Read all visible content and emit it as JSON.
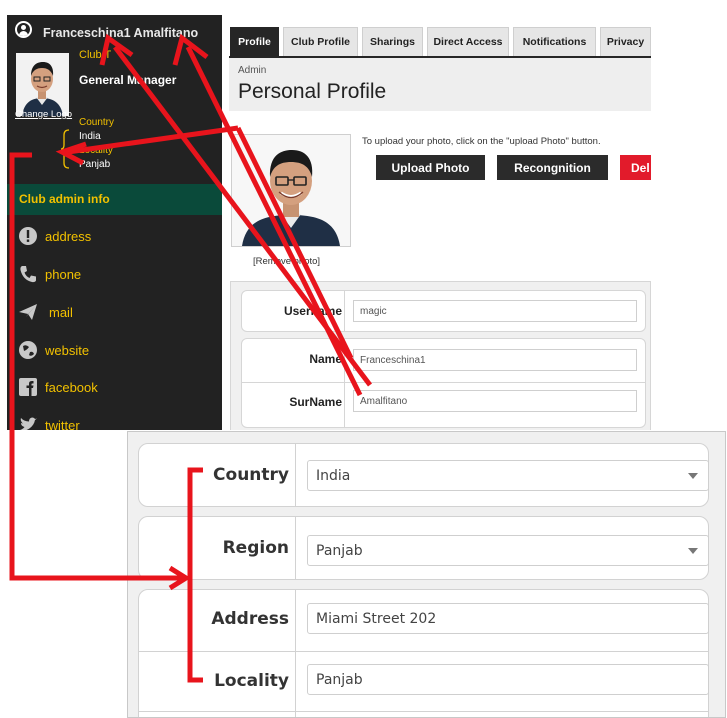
{
  "sidebar": {
    "user_name": "Franceschina1 Amalfitano",
    "club_label": "Club T",
    "role": "General Manager",
    "change_logo": "Change Logo",
    "location": [
      "Country",
      "India",
      "Locality",
      "Panjab"
    ],
    "club_admin_title": "Club admin info",
    "items": [
      {
        "label": "address",
        "icon": "exclamation-circle-icon"
      },
      {
        "label": "phone",
        "icon": "phone-icon"
      },
      {
        "label": "mail",
        "icon": "paper-plane-icon"
      },
      {
        "label": "website",
        "icon": "globe-icon"
      },
      {
        "label": "facebook",
        "icon": "facebook-icon"
      },
      {
        "label": "twitter",
        "icon": "twitter-icon"
      }
    ]
  },
  "tabs": [
    {
      "label": "Profile",
      "active": true
    },
    {
      "label": "Club Profile",
      "active": false
    },
    {
      "label": "Sharings",
      "active": false
    },
    {
      "label": "Direct Access",
      "active": false
    },
    {
      "label": "Notifications",
      "active": false
    },
    {
      "label": "Privacy",
      "active": false
    }
  ],
  "header": {
    "breadcrumb": "Admin",
    "title": "Personal Profile"
  },
  "photo": {
    "remove_label": "[Remove photo]",
    "hint": "To upload your photo, click on the \"upload Photo\" button.",
    "upload_label": "Upload Photo",
    "recognition_label": "Recongnition",
    "delete_label": "Del"
  },
  "form": {
    "username": {
      "label": "Username",
      "value": "magic"
    },
    "name": {
      "label": "Name",
      "value": "Franceschina1"
    },
    "surname": {
      "label": "SurName",
      "value": "Amalfitano"
    }
  },
  "zoom": {
    "country": {
      "label": "Country",
      "value": "India"
    },
    "region": {
      "label": "Region",
      "value": "Panjab"
    },
    "address": {
      "label": "Address",
      "value": "Miami Street 202"
    },
    "locality": {
      "label": "Locality",
      "value": "Panjab"
    }
  },
  "colors": {
    "accent_yellow": "#f2c100",
    "annotation_red": "#e8141c",
    "sidebar_bg": "#222222",
    "club_admin_bg": "#0a4a3a",
    "delete_red": "#e21b2b"
  }
}
